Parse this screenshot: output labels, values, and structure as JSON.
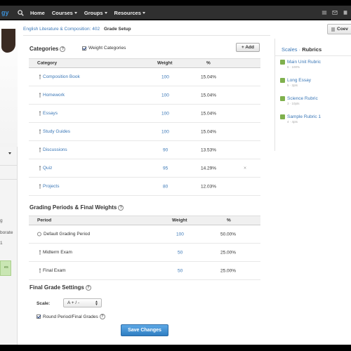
{
  "app": {
    "logo_fragment": "gy"
  },
  "nav": {
    "items": [
      {
        "label": "Home"
      },
      {
        "label": "Courses"
      },
      {
        "label": "Groups"
      },
      {
        "label": "Resources"
      }
    ]
  },
  "sidebar": {
    "fragments": [
      "g",
      "borate",
      "1",
      "es"
    ]
  },
  "breadcrumb": {
    "course": "English Literature & Composition: 402",
    "current": "Grade Setup"
  },
  "header": {
    "button_label": "Coev"
  },
  "categories": {
    "title": "Categories",
    "weight_categories_label": "Weight Categories",
    "add_label": "+ Add",
    "columns": [
      "Category",
      "Weight",
      "%"
    ],
    "rows": [
      {
        "name": "Composition Book",
        "weight": "100",
        "pct": "15.04%"
      },
      {
        "name": "Homework",
        "weight": "100",
        "pct": "15.04%"
      },
      {
        "name": "Essays",
        "weight": "100",
        "pct": "15.04%"
      },
      {
        "name": "Study Guides",
        "weight": "100",
        "pct": "15.04%"
      },
      {
        "name": "Discussions",
        "weight": "90",
        "pct": "13.53%"
      },
      {
        "name": "Quiz",
        "weight": "95",
        "pct": "14.29%",
        "delete": "×"
      },
      {
        "name": "Projects",
        "weight": "80",
        "pct": "12.03%"
      }
    ]
  },
  "periods": {
    "title": "Grading Periods & Final Weights",
    "columns": [
      "Period",
      "Weight",
      "%"
    ],
    "rows": [
      {
        "name": "Default Grading Period",
        "weight": "100",
        "pct": "50.00%"
      },
      {
        "name": "Midterm Exam",
        "weight": "50",
        "pct": "25.00%"
      },
      {
        "name": "Final Exam",
        "weight": "50",
        "pct": "25.00%"
      }
    ]
  },
  "final": {
    "title": "Final Grade Settings",
    "scale_label": "Scale:",
    "scale_value": "A + / -",
    "round_label": "Round Period/Final Grades",
    "save_label": "Save Changes"
  },
  "rubrics": {
    "title_link": "Scales",
    "title_sep": " · ",
    "title_current": "Rubrics",
    "items": [
      {
        "name": "Main Unit Rubric",
        "sub": "6 · 100%"
      },
      {
        "name": "Long Essay",
        "sub": "5 · 2pts"
      },
      {
        "name": "Science Rubric",
        "sub": "3 · 10pts"
      },
      {
        "name": "Sample Rubric 1",
        "sub": "4 · 4pts"
      }
    ]
  }
}
